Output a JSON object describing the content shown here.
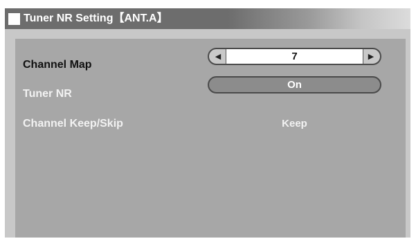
{
  "window": {
    "title": "Tuner NR Setting【ANT.A】",
    "title_icon": "white-square"
  },
  "rows": [
    {
      "label": "Channel Map",
      "value": "7",
      "control": "selector",
      "left_icon": "triangle-left",
      "right_icon": "triangle-right"
    },
    {
      "label": "Tuner NR",
      "value": "On",
      "control": "pill"
    },
    {
      "label": "Channel  Keep/Skip",
      "value": "Keep",
      "control": "text"
    }
  ],
  "colors": {
    "frame": "#c8c8c8",
    "title_bar": "#6d6d6d",
    "panel": "#a7a7a7",
    "active_text": "#111111",
    "inactive_text": "#f2f2f2"
  }
}
